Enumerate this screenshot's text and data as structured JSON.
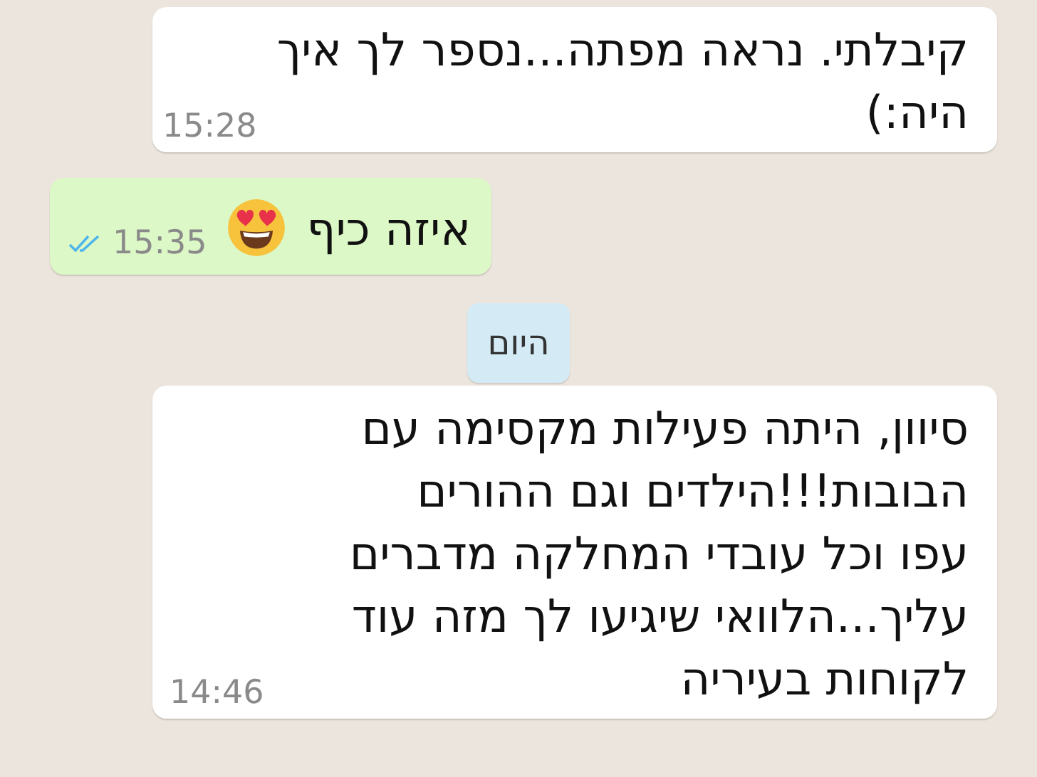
{
  "messages": [
    {
      "kind": "message",
      "outgoing": false,
      "text": "קיבלתי. נראה מפתה...נספר לך איך\nהיה:)",
      "time": "15:28"
    },
    {
      "kind": "message",
      "outgoing": true,
      "text": "איזה כיף",
      "emoji": true,
      "time": "15:35",
      "read": true
    },
    {
      "kind": "date",
      "text": "היום"
    },
    {
      "kind": "message",
      "outgoing": false,
      "text": "סיוון, היתה פעילות מקסימה עם\nהבובות!!!הילדים וגם ההורים\nעפו וכל עובדי המחלקה מדברים\nעליך...הלוואי שיגיעו לך מזה עוד\nלקוחות בעיריה",
      "time": "14:46"
    }
  ]
}
